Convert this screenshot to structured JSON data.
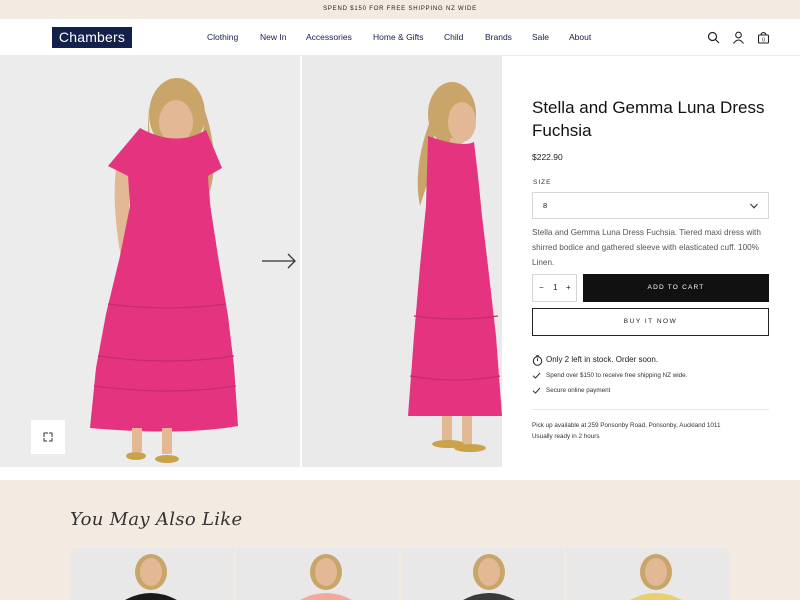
{
  "announcement": "SPEND $150 FOR FREE SHIPPING NZ WIDE",
  "brand": {
    "logo_text": "Chambers",
    "logo_color": "#13204a"
  },
  "nav": {
    "items": [
      {
        "label": "Clothing"
      },
      {
        "label": "New In"
      },
      {
        "label": "Accessories"
      },
      {
        "label": "Home & Gifts"
      },
      {
        "label": "Child"
      },
      {
        "label": "Brands"
      },
      {
        "label": "Sale"
      },
      {
        "label": "About"
      }
    ]
  },
  "header_icons": [
    "search-icon",
    "account-icon",
    "cart-icon"
  ],
  "product": {
    "title": "Stella and Gemma Luna Dress Fuchsia",
    "price": "$222.90",
    "size_label": "SIZE",
    "size_value": "8",
    "description": "Stella and Gemma Luna Dress Fuchsia.  Tiered maxi dress with shirred bodice and gathered sleeve with elasticated cuff.  100% Linen.",
    "quantity": "1",
    "qty_minus": "−",
    "qty_plus": "+",
    "add_to_cart": "ADD TO CART",
    "buy_now": "BUY IT NOW",
    "stock_note": "Only 2 left in stock. Order soon.",
    "shipping_note": "Spend over $150 to receive free shipping NZ wide.",
    "payment_note": "Secure online payment",
    "pickup_line1": "Pick up available at 259 Ponsonby Road, Ponsonby, Auckland 1011",
    "pickup_line2": "Usually ready in 2 hours",
    "dress_color": "#e5347f"
  },
  "recommendations": {
    "title": "You May Also Like",
    "card_colors": [
      "#1a1a1a",
      "#f3a89a",
      "#3a3a3a",
      "#e8d070"
    ]
  }
}
